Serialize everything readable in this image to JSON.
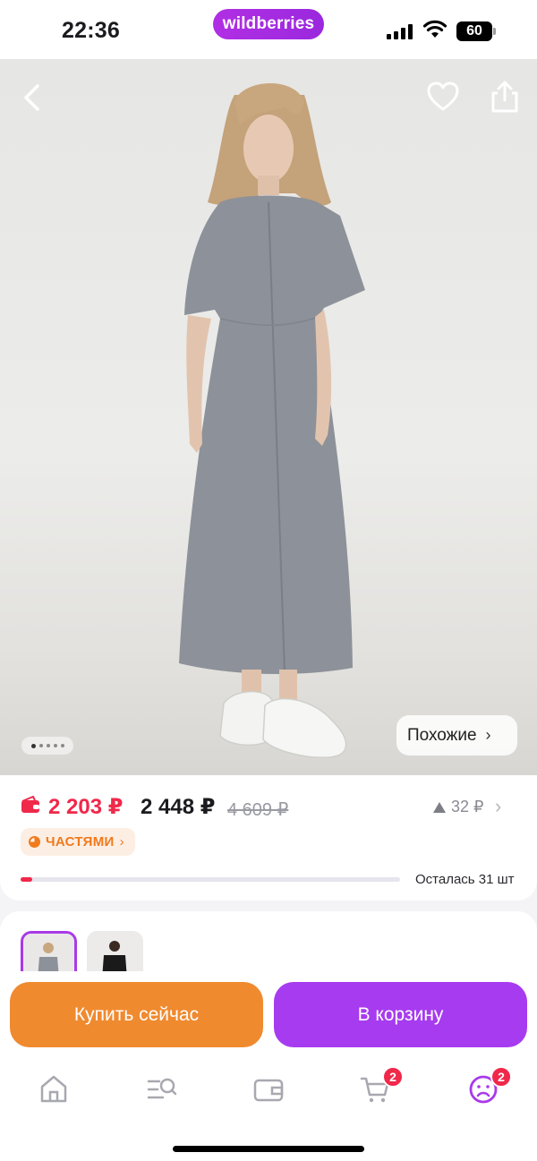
{
  "status_bar": {
    "time": "22:36",
    "brand": "wildberries",
    "battery": "60"
  },
  "product": {
    "gallery": {
      "total_images": 5,
      "current_image": 1
    },
    "similar_label": "Похожие"
  },
  "price": {
    "wallet_price": "2 203 ₽",
    "price": "2 448 ₽",
    "old_price": "4 609 ₽",
    "points": "32 ₽",
    "installments_label": "ЧАСТЯМИ",
    "stock_text": "Осталась 31 шт",
    "stock_level": 0.03
  },
  "variants": [
    {
      "color": "grey",
      "selected": true
    },
    {
      "color": "black",
      "selected": false
    }
  ],
  "actions": {
    "buy_now": "Купить сейчас",
    "add_to_cart": "В корзину"
  },
  "tabbar": {
    "items": [
      {
        "icon": "home-icon"
      },
      {
        "icon": "catalog-search-icon"
      },
      {
        "icon": "wallet-icon"
      },
      {
        "icon": "cart-icon",
        "badge": "2"
      },
      {
        "icon": "profile-icon",
        "badge": "2"
      }
    ]
  },
  "colors": {
    "accent_purple": "#a73bf0",
    "accent_orange": "#f08a2f",
    "price_red": "#f0284a"
  }
}
